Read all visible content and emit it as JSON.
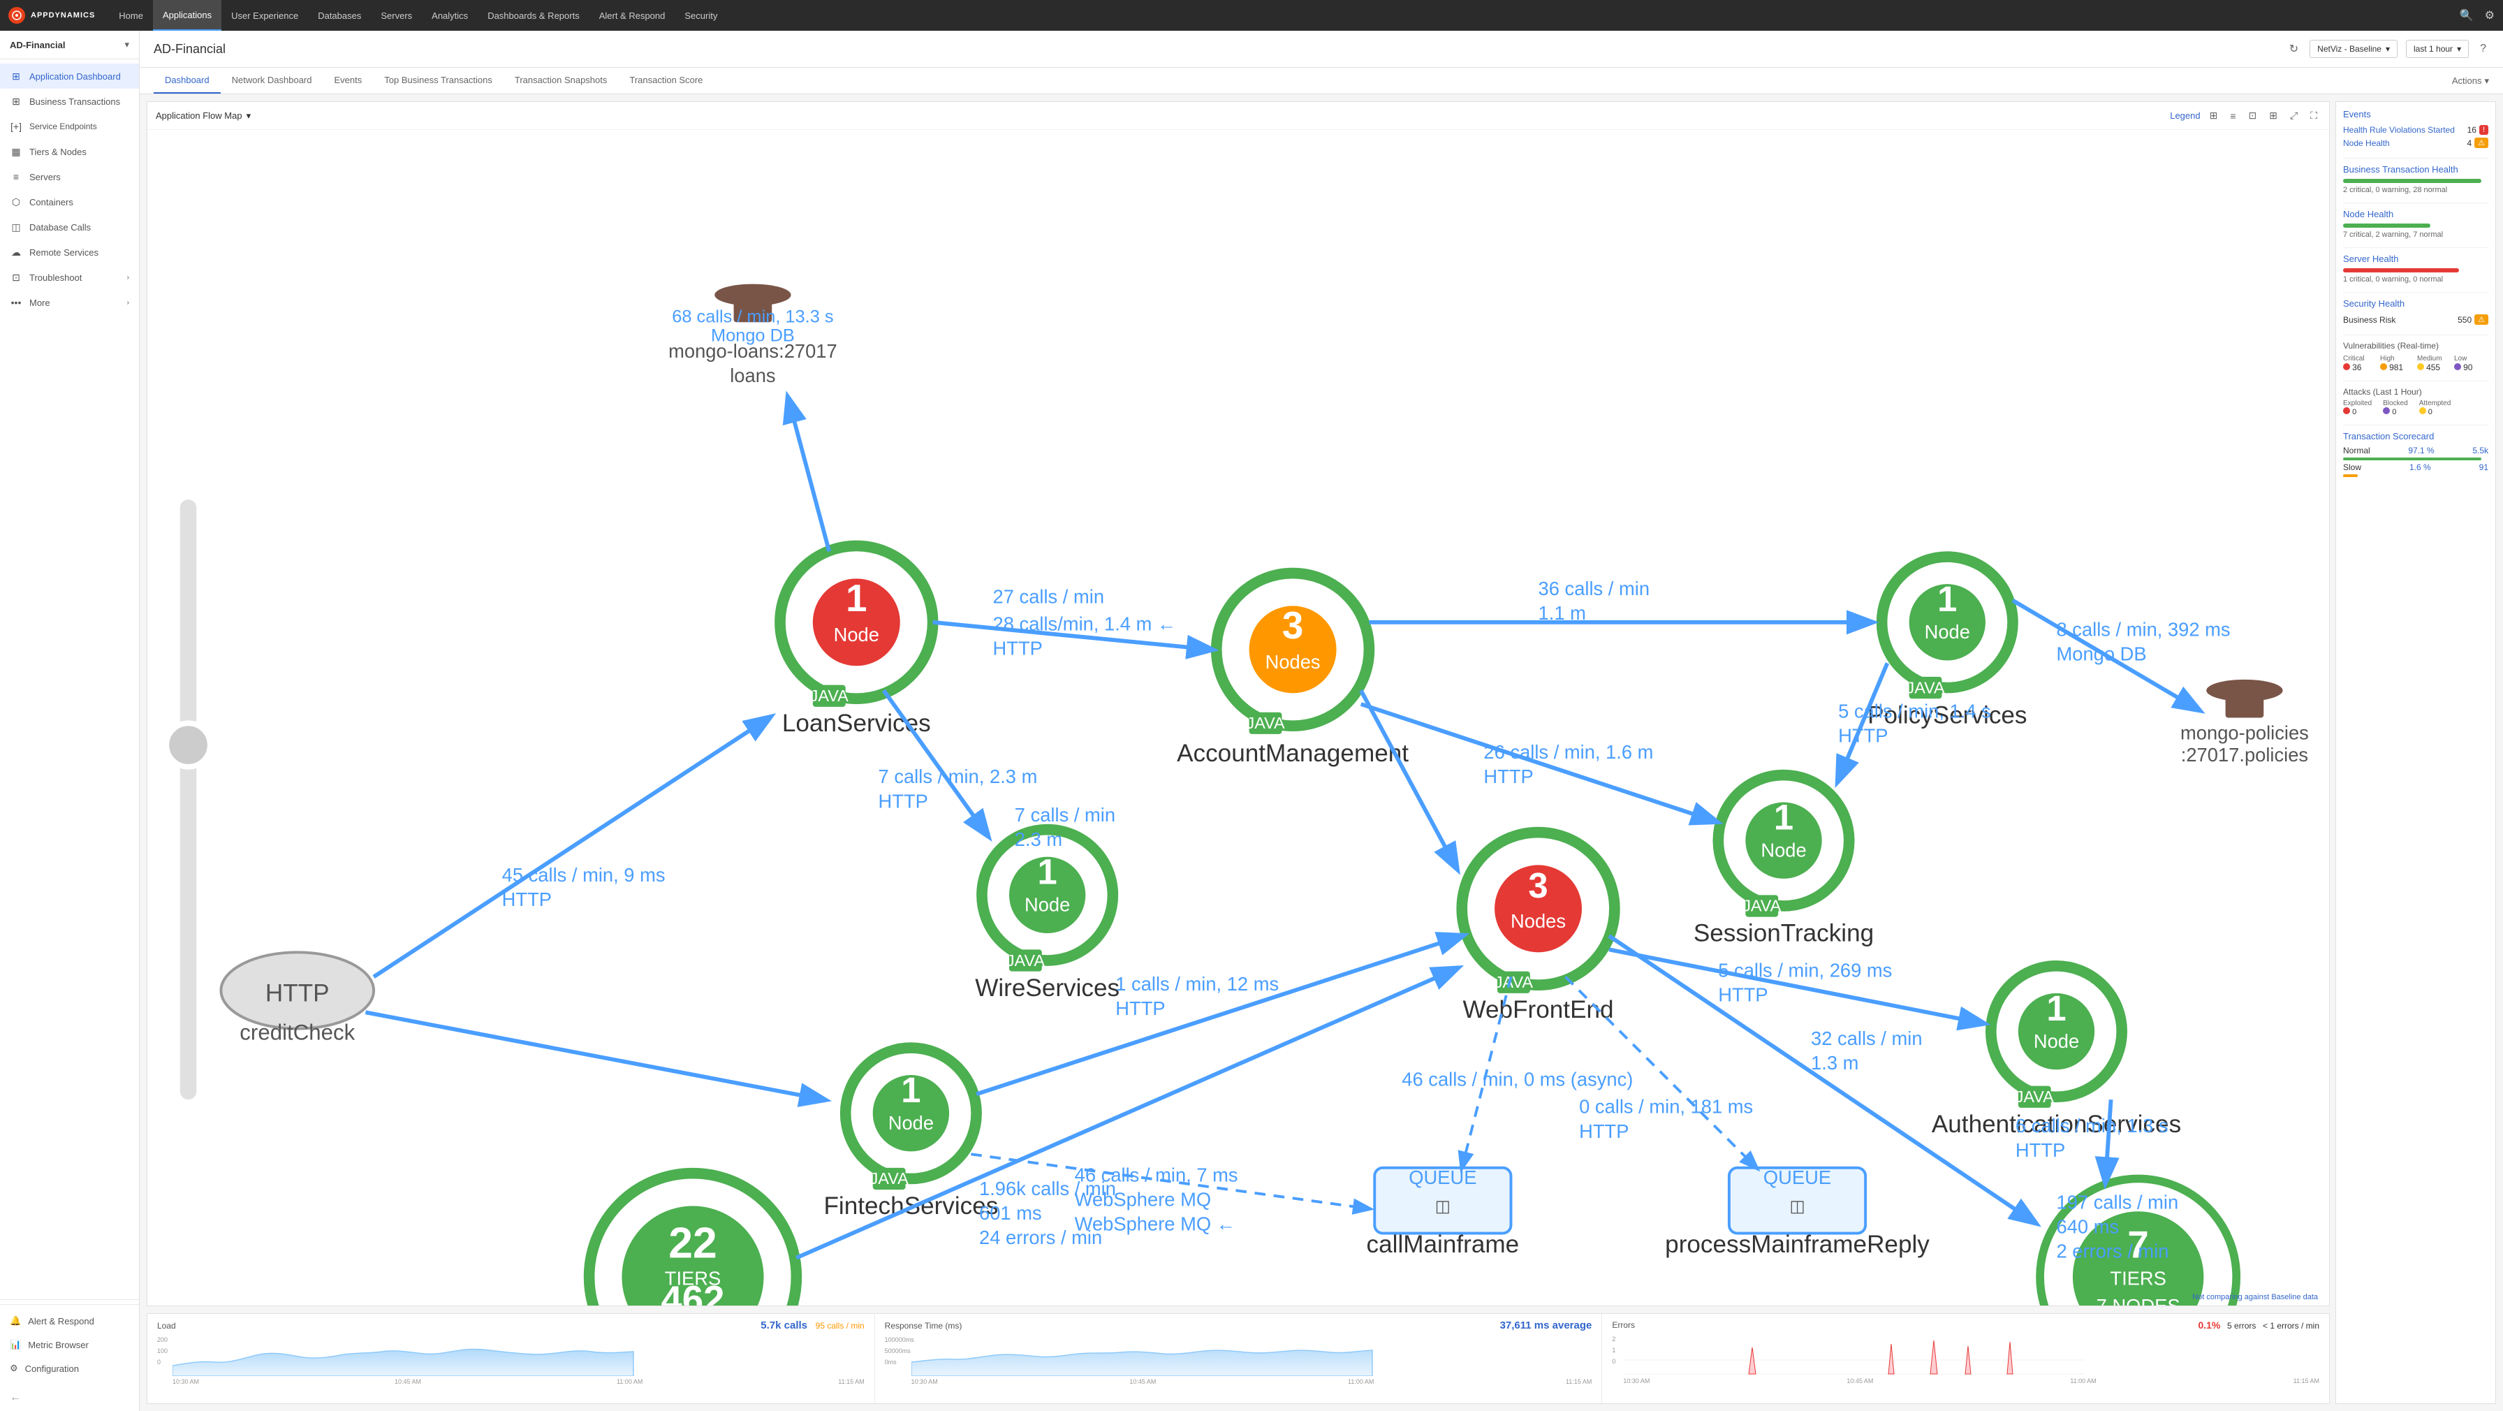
{
  "app": {
    "logo_text": "AD",
    "name": "APPDYNAMICS"
  },
  "top_nav": {
    "items": [
      {
        "label": "Home",
        "active": false
      },
      {
        "label": "Applications",
        "active": true
      },
      {
        "label": "User Experience",
        "active": false
      },
      {
        "label": "Databases",
        "active": false
      },
      {
        "label": "Servers",
        "active": false
      },
      {
        "label": "Analytics",
        "active": false
      },
      {
        "label": "Dashboards & Reports",
        "active": false
      },
      {
        "label": "Alert & Respond",
        "active": false
      },
      {
        "label": "Security",
        "active": false
      }
    ]
  },
  "page_header": {
    "title": "AD-Financial",
    "app_selector": "AD-Financial",
    "netviz_label": "NetViz - Baseline",
    "time_label": "last 1 hour"
  },
  "tabs": {
    "items": [
      {
        "label": "Dashboard",
        "active": true
      },
      {
        "label": "Network Dashboard",
        "active": false
      },
      {
        "label": "Events",
        "active": false
      },
      {
        "label": "Top Business Transactions",
        "active": false
      },
      {
        "label": "Transaction Snapshots",
        "active": false
      },
      {
        "label": "Transaction Score",
        "active": false
      }
    ],
    "actions_label": "Actions"
  },
  "sidebar": {
    "app_name": "AD-Financial",
    "items": [
      {
        "label": "Application Dashboard",
        "icon": "⊞",
        "active": true
      },
      {
        "label": "Business Transactions",
        "icon": "⊞",
        "active": false
      },
      {
        "label": "Service Endpoints",
        "icon": "[+]",
        "active": false
      },
      {
        "label": "Tiers & Nodes",
        "icon": "▦",
        "active": false
      },
      {
        "label": "Servers",
        "icon": "≡",
        "active": false
      },
      {
        "label": "Containers",
        "icon": "⬡",
        "active": false
      },
      {
        "label": "Database Calls",
        "icon": "◫",
        "active": false
      },
      {
        "label": "Remote Services",
        "icon": "☁",
        "active": false
      },
      {
        "label": "Troubleshoot",
        "icon": "⊡",
        "active": false,
        "has_chevron": true
      },
      {
        "label": "More",
        "icon": "•••",
        "active": false,
        "has_chevron": true
      }
    ],
    "bottom_items": [
      {
        "label": "Alert & Respond",
        "icon": "🔔"
      },
      {
        "label": "Metric Browser",
        "icon": "📊"
      },
      {
        "label": "Configuration",
        "icon": "⚙"
      }
    ]
  },
  "flow_map": {
    "title": "Application Flow Map",
    "legend_label": "Legend",
    "baseline_note": "Not comparing against Baseline data"
  },
  "right_panel": {
    "events_title": "Events",
    "events_items": [
      {
        "label": "Health Rule Violations Started",
        "value": "16",
        "badge": "red"
      },
      {
        "label": "Node Health",
        "value": "4",
        "badge": "yellow"
      }
    ],
    "bt_health_title": "Business Transaction Health",
    "bt_health_desc": "2 critical, 0 warning, 28 normal",
    "bt_bar_width": "95",
    "node_health_title": "Node Health",
    "node_health_desc": "7 critical, 2 warning, 7 normal",
    "node_bar_width": "60",
    "server_health_title": "Server Health",
    "server_health_desc": "1 critical, 0 warning, 0 normal",
    "server_bar_width": "10",
    "security_health_title": "Security Health",
    "business_risk_label": "Business Risk",
    "business_risk_value": "550",
    "vulns_title": "Vulnerabilities (Real-time)",
    "vuln_labels": [
      "Critical",
      "High",
      "Medium",
      "Low"
    ],
    "vuln_values": [
      "36",
      "981",
      "455",
      "90"
    ],
    "attacks_title": "Attacks (Last 1 Hour)",
    "attack_labels": [
      "Exploited",
      "Blocked",
      "Attempted"
    ],
    "attack_values": [
      "0",
      "0",
      "0"
    ],
    "tc_title": "Transaction Scorecard",
    "tc_normal_label": "Normal",
    "tc_normal_pct": "97.1 %",
    "tc_normal_count": "5.5k",
    "tc_slow_label": "Slow",
    "tc_slow_pct": "1.6 %",
    "tc_slow_count": "91"
  },
  "bottom_stats": {
    "load_title": "Load",
    "load_calls": "5.7k calls",
    "load_rate": "95 calls / min",
    "load_y_labels": [
      "200",
      "100",
      "0"
    ],
    "load_x_labels": [
      "10:30 AM",
      "10:45 AM",
      "11:00 AM",
      "11:15 AM"
    ],
    "response_title": "Response Time (ms)",
    "response_avg": "37,611 ms average",
    "response_y_labels": [
      "100000ms",
      "50000ms",
      "0ms"
    ],
    "response_x_labels": [
      "10:30 AM",
      "10:45 AM",
      "11:00 AM",
      "11:15 AM"
    ],
    "errors_title": "Errors",
    "errors_pct": "0.1%",
    "errors_count": "5 errors",
    "errors_rate": "< 1 errors / min",
    "errors_y_labels": [
      "2",
      "1",
      "0"
    ],
    "errors_x_labels": [
      "10:30 AM",
      "10:45 AM",
      "11:00 AM",
      "11:15 AM"
    ]
  }
}
